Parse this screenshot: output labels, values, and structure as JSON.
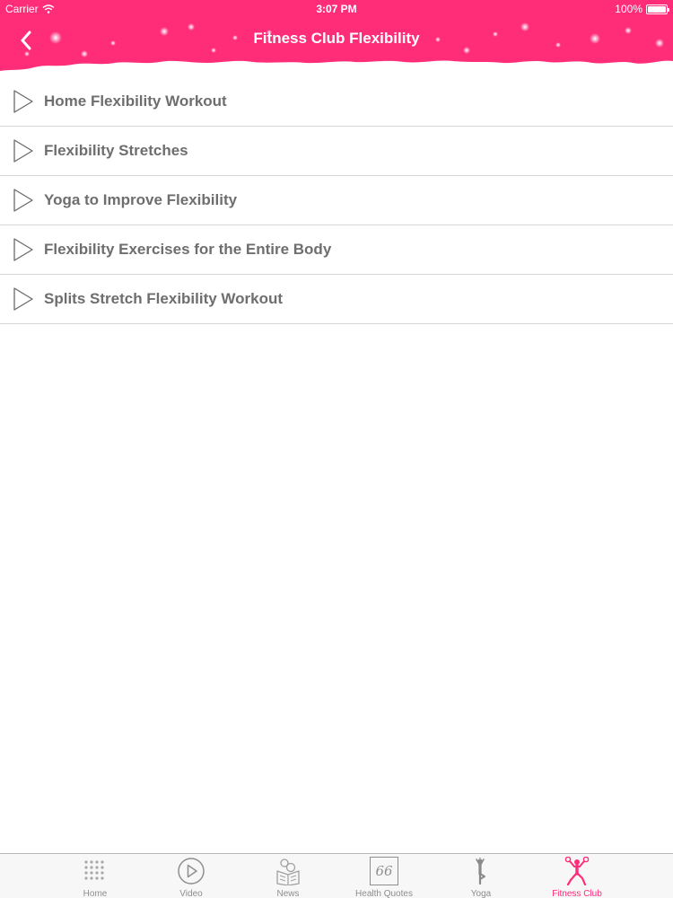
{
  "status_bar": {
    "carrier": "Carrier",
    "time": "3:07 PM",
    "battery": "100%"
  },
  "nav": {
    "title": "Fitness Club Flexibility",
    "back_icon": "chevron-left-icon"
  },
  "colors": {
    "header": "#ff2d78",
    "active_tab": "#ff2d78",
    "item_text": "#6e6e6e"
  },
  "list": {
    "items": [
      {
        "label": "Home Flexibility Workout",
        "icon": "play-outline-icon"
      },
      {
        "label": "Flexibility Stretches",
        "icon": "play-outline-icon"
      },
      {
        "label": "Yoga to Improve Flexibility",
        "icon": "play-outline-icon"
      },
      {
        "label": "Flexibility Exercises for the Entire Body",
        "icon": "play-outline-icon"
      },
      {
        "label": "Splits Stretch Flexibility Workout",
        "icon": "play-outline-icon"
      }
    ]
  },
  "tabbar": {
    "tabs": [
      {
        "label": "Home",
        "icon": "grid-dots-icon",
        "active": false
      },
      {
        "label": "Video",
        "icon": "play-circle-icon",
        "active": false
      },
      {
        "label": "News",
        "icon": "newspaper-icon",
        "active": false
      },
      {
        "label": "Health Quotes",
        "icon": "quote-icon",
        "active": false
      },
      {
        "label": "Yoga",
        "icon": "yoga-pose-icon",
        "active": false
      },
      {
        "label": "Fitness Club",
        "icon": "fitness-figure-icon",
        "active": true
      }
    ],
    "quote_glyph": "66"
  }
}
